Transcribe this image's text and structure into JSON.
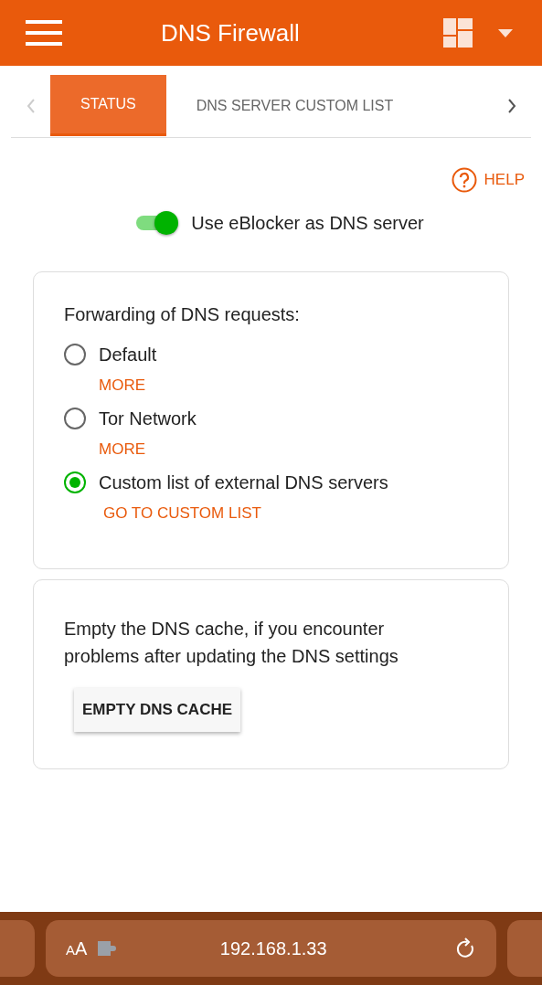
{
  "header": {
    "title": "DNS Firewall"
  },
  "tabs": [
    {
      "label": "STATUS",
      "selected": true
    },
    {
      "label": "DNS SERVER CUSTOM LIST",
      "selected": false
    }
  ],
  "help": {
    "label": "HELP"
  },
  "dns_toggle": {
    "label": "Use eBlocker as DNS server",
    "on": true
  },
  "forwarding": {
    "title": "Forwarding of DNS requests:",
    "options": [
      {
        "label": "Default",
        "selected": false,
        "link": "MORE"
      },
      {
        "label": "Tor Network",
        "selected": false,
        "link": "MORE"
      },
      {
        "label": "Custom list of external DNS servers",
        "selected": true,
        "link": "GO TO CUSTOM LIST"
      }
    ]
  },
  "cache": {
    "text": "Empty the DNS cache, if you encounter problems after updating the DNS settings",
    "button": "EMPTY DNS CACHE"
  },
  "browser_bar": {
    "text_size": "AA",
    "url": "192.168.1.33"
  }
}
